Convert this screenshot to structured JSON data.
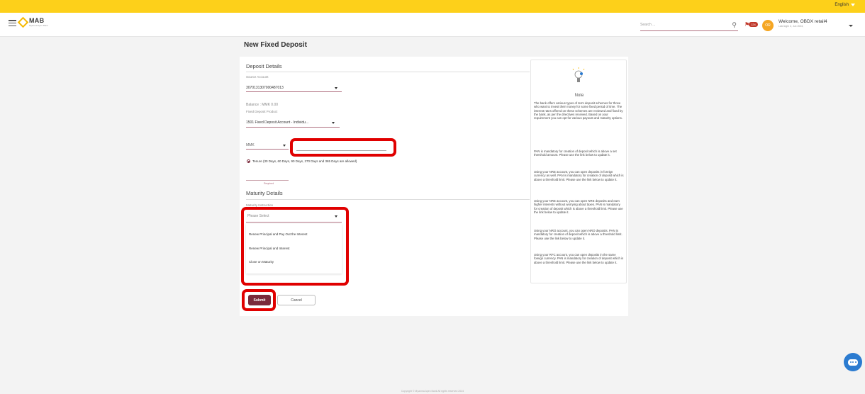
{
  "header": {
    "language": "English",
    "brand": "MAB",
    "brand_sub": "Myanma Apex Bank",
    "search_placeholder": "Search ...",
    "notification_count": "124",
    "avatar_initials": "OR",
    "welcome": "Welcome, OBDX retail4",
    "last_login": "Last login 2, Jun 2024,"
  },
  "page": {
    "title": "New Fixed Deposit"
  },
  "deposit": {
    "section_title": "Deposit Details",
    "source_account_label": "Source Account",
    "source_account_value": "3070131307000487013",
    "balance": "Balance : MMK 0.00",
    "product_label": "Fixed Deposit Product",
    "product_value": "1501 Fixed Deposit Account - Individu...",
    "currency": "MMK",
    "tenure_text": "Tenure (30 Days, 60 Days, 90 Days, 270 Days and 365 Days are allowed)",
    "required": "Required"
  },
  "maturity": {
    "section_title": "Maturity Details",
    "instruction_label": "Maturity Instruction",
    "select_placeholder": "Please Select",
    "options": [
      "Renew Principal and Pay Out the Interest",
      "Renew Principal and Interest",
      "Close on Maturity"
    ]
  },
  "actions": {
    "submit": "Submit",
    "cancel": "Cancel"
  },
  "note": {
    "title": "Note",
    "paragraphs": [
      "The bank offers various types of term deposit schemes for those who want to invest their money for some fixed period of time. The interest rates offered on these schemes are reviewed and fixed by the bank, as per the directives received. Based on your requirement you can opt for various payouts and maturity options.",
      "PAN is mandatory for creation of deposit which is above a set threshold amount. Please use the link below to update it.",
      "Using your NRE account, you can open deposits in foreign currency as well. PAN is mandatory for creation of deposit which is above a threshold limit. Please use the link below to update it.",
      "Using your NRE account, you can open NRE deposits and earn higher interests without worrying about taxes. PAN is mandatory for creation of deposit which is above a threshold limit. Please use the link below to update it.",
      "Using your NRO account, you can open NRO deposits. PAN is mandatory for creation of deposit which is above a threshold limit. Please use the link below to update it.",
      "Using your RFC account, you can open deposits in the same foreign currency. PAN is mandatory for creation of deposit which is above a threshold limit. Please use the link below to update it."
    ]
  },
  "footer": {
    "copyright": "Copyright © Myanma Apex Bank All rights reserved 2024"
  }
}
